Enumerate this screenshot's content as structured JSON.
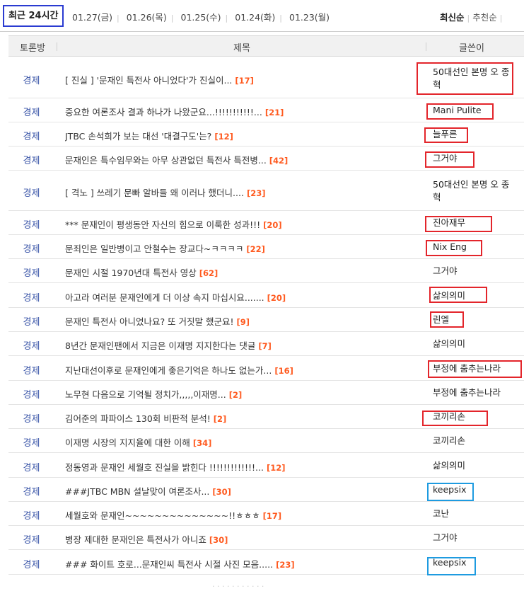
{
  "top": {
    "active_tab": "최근 24시간",
    "dates": [
      "01.27(금)",
      "01.26(목)",
      "01.25(수)",
      "01.24(화)",
      "01.23(월)"
    ],
    "sort_latest": "최신순",
    "sort_recommend": "추천순",
    "sort_sep": "|"
  },
  "table": {
    "col_board": "토론방",
    "col_title": "제목",
    "col_author": "글쓴이"
  },
  "rows": [
    {
      "category": "경제",
      "title": "[ 진실 ] '문재인 특전사 아니었다'가 진실이...",
      "count": "[17]",
      "author": "50대선인 본명 오 종혁"
    },
    {
      "category": "경제",
      "title": "중요한 여론조사 결과 하나가 나왔군요...!!!!!!!!!!!...",
      "count": "[21]",
      "author": "Mani Pulite"
    },
    {
      "category": "경제",
      "title": "JTBC 손석희가 보는 대선 '대결구도'는?",
      "count": "[12]",
      "author": "늘푸른"
    },
    {
      "category": "경제",
      "title": "문재인은 특수임무와는 아무 상관없던 특전사 특전병...",
      "count": "[42]",
      "author": "그거야"
    },
    {
      "category": "경제",
      "title": "[ 격노 ] 쓰레기 문빠 알바들 왜 이러나 했더니....",
      "count": "[23]",
      "author": "50대선인 본명 오 종혁"
    },
    {
      "category": "경제",
      "title": "*** 문재인이 평생동안 자신의 힘으로 이룩한 성과!!!",
      "count": "[20]",
      "author": "진아재무"
    },
    {
      "category": "경제",
      "title": "문죄인은 일반병이고 안철수는 장교다~ㅋㅋㅋㅋ",
      "count": "[22]",
      "author": "Nix Eng"
    },
    {
      "category": "경제",
      "title": "문재인 시절 1970년대 특전사 영상",
      "count": "[62]",
      "author": "그거야"
    },
    {
      "category": "경제",
      "title": "아고라 여러분 문재인에게 더 이상 속지 마십시요.......",
      "count": "[20]",
      "author": "삶의의미"
    },
    {
      "category": "경제",
      "title": "문재인 특전사 아니었나요? 또 거짓말 했군요!",
      "count": "[9]",
      "author": "린엘"
    },
    {
      "category": "경제",
      "title": "8년간 문재인팬에서 지금은 이재명 지지한다는 댓글",
      "count": "[7]",
      "author": "삶의의미"
    },
    {
      "category": "경제",
      "title": "지난대선이후로 문재인에게 좋은기억은 하나도 없는가...",
      "count": "[16]",
      "author": "부정에 춤추는나라"
    },
    {
      "category": "경제",
      "title": "노무현 다음으로 기억될 정치가,,,,,이재명...",
      "count": "[2]",
      "author": "부정에 춤추는나라"
    },
    {
      "category": "경제",
      "title": "김어준의 파파이스 130회 비판적 분석!",
      "count": "[2]",
      "author": "코끼리손"
    },
    {
      "category": "경제",
      "title": "이재명 시장의 지지율에 대한 이해",
      "count": "[34]",
      "author": "코끼리손"
    },
    {
      "category": "경제",
      "title": "정동영과 문재인 세월호 진실을 밝힌다 !!!!!!!!!!!!!...",
      "count": "[12]",
      "author": "삶의의미"
    },
    {
      "category": "경제",
      "title": "###JTBC MBN 설날맞이 여론조사...",
      "count": "[30]",
      "author": "keepsix"
    },
    {
      "category": "경제",
      "title": "세월호와 문재인~~~~~~~~~~~~~~!!ㅎㅎㅎ",
      "count": "[17]",
      "author": "코난"
    },
    {
      "category": "경제",
      "title": "병장 제대한 문재인은 특전사가 아니죠",
      "count": "[30]",
      "author": "그거야"
    },
    {
      "category": "경제",
      "title": "### 화이트 호로...문재인씨 특전사 시절 사진 모음.....",
      "count": "[23]",
      "author": "keepsix"
    }
  ],
  "colors": {
    "highlight_red": "#e3252b",
    "highlight_blue": "#1e9be0",
    "active_tab_border": "#2a3bd1",
    "count_orange": "#ff5a1f",
    "category_blue": "#3a55a8"
  }
}
